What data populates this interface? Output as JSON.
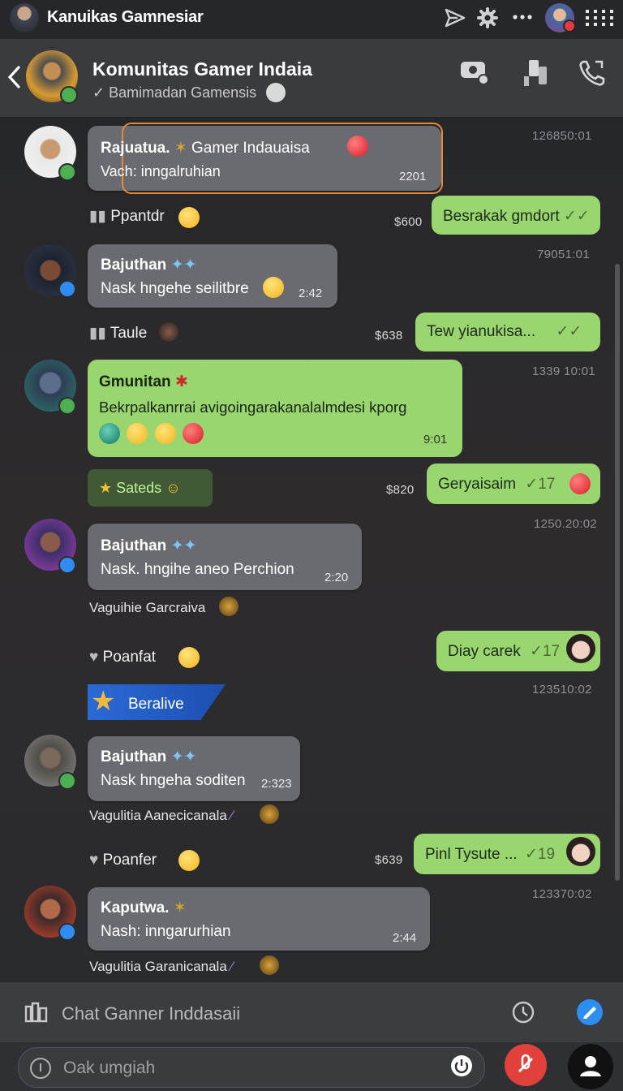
{
  "topbar": {
    "title": "Kanuikas Gamnesiar"
  },
  "header": {
    "name": "Komunitas Gamer Indaia",
    "subtitle": "✓ Bamimadan Gamensis"
  },
  "messages": {
    "m1": {
      "title": "Rajuatua. ",
      "title2": "Gamer Indauaisa",
      "text": "Vach: inngalruhian",
      "time": "2201",
      "ts": "126850:01"
    },
    "s1": {
      "label": "Ppantdr"
    },
    "o1": {
      "text": "Besrakak gmdort",
      "price": "$600"
    },
    "m2": {
      "title": "Bajuthan",
      "text": "Nask hngehe seilitbre",
      "time": "2:42",
      "ts": "79051:01"
    },
    "s2": {
      "label": "Taule"
    },
    "o2": {
      "text": "Tew yianukisa...",
      "price": "$638"
    },
    "m3": {
      "title": "Gmunitan",
      "text": "Bekrpalkanrrai avigoingarakanalalmdesi kporg",
      "time": "9:01",
      "ts": "1339 10:01"
    },
    "s3": {
      "label": "Sateds"
    },
    "o3": {
      "text": "Geryaisaim",
      "ticks": "✓17",
      "price": "$820"
    },
    "m4": {
      "title": "Bajuthan",
      "text": "Nask. hngihe aneo Perchion",
      "time": "2:20",
      "ts": "1250.20:02"
    },
    "c4": {
      "text": "Vaguihie Garcraiva"
    },
    "s4": {
      "label": "Poanfat"
    },
    "o4": {
      "text": "Diay carek",
      "ticks": "✓17"
    },
    "s5": {
      "label": "Beralive",
      "ts": "123510:02"
    },
    "m5": {
      "title": "Bajuthan",
      "text": "Nask hngeha soditen",
      "time": "2:323"
    },
    "c5": {
      "text": "Vagulitia Aanecicanala"
    },
    "s6": {
      "label": "Poanfer"
    },
    "o5": {
      "text": "Pinl Tysute ...",
      "ticks": "✓19",
      "price": "$639"
    },
    "m6": {
      "title": "Kaputwa.",
      "text": "Nash: inngarurhian",
      "time": "2:44",
      "ts": "123370:02"
    },
    "c6": {
      "text": "Vagulitia Garanicanala"
    }
  },
  "composer": {
    "field": "Chat Ganner Inddasaii",
    "input_placeholder": "Oak umgiah"
  },
  "colors": {
    "incoming": "#6a6b70",
    "outgoing": "#9ad66f",
    "accent_highlight": "#e8893a",
    "check_blue": "#2f8cf0",
    "check_green": "#4caf50"
  },
  "icons": [
    "back-icon",
    "send-icon",
    "settings-icon",
    "more-icon",
    "grid-icon",
    "video-camera-icon",
    "phone-bookmark-icon",
    "call-icon",
    "verified-icon",
    "star-icon",
    "heart-icon",
    "clock-icon",
    "pen-icon",
    "mic-icon",
    "power-icon",
    "red-mic-off-icon",
    "profile-icon"
  ]
}
